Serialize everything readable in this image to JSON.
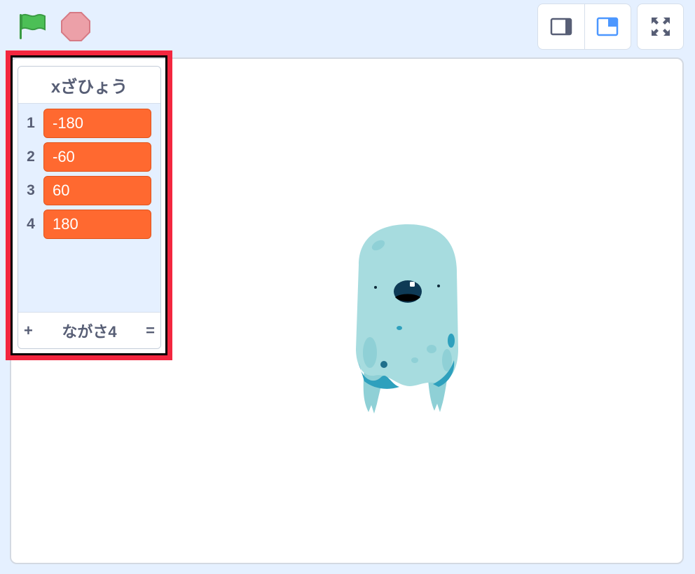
{
  "controls": {
    "green_flag_icon": "green-flag-icon",
    "stop_icon": "stop-icon",
    "small_stage_icon": "small-stage-icon",
    "normal_stage_icon": "normal-stage-icon",
    "fullscreen_icon": "fullscreen-icon"
  },
  "list_monitor": {
    "title": "xざひょう",
    "items": [
      {
        "index": "1",
        "value": "-180"
      },
      {
        "index": "2",
        "value": "-60"
      },
      {
        "index": "3",
        "value": "60"
      },
      {
        "index": "4",
        "value": "180"
      }
    ],
    "footer": {
      "add_symbol": "+",
      "length_label": "ながさ4",
      "resize_symbol": "="
    }
  },
  "colors": {
    "background": "#e5f0ff",
    "list_item": "#ff6930",
    "highlight": "#f3263f",
    "flag": "#4cbf56",
    "stop": "#ec9c9c",
    "accent_blue": "#4c97ff"
  }
}
